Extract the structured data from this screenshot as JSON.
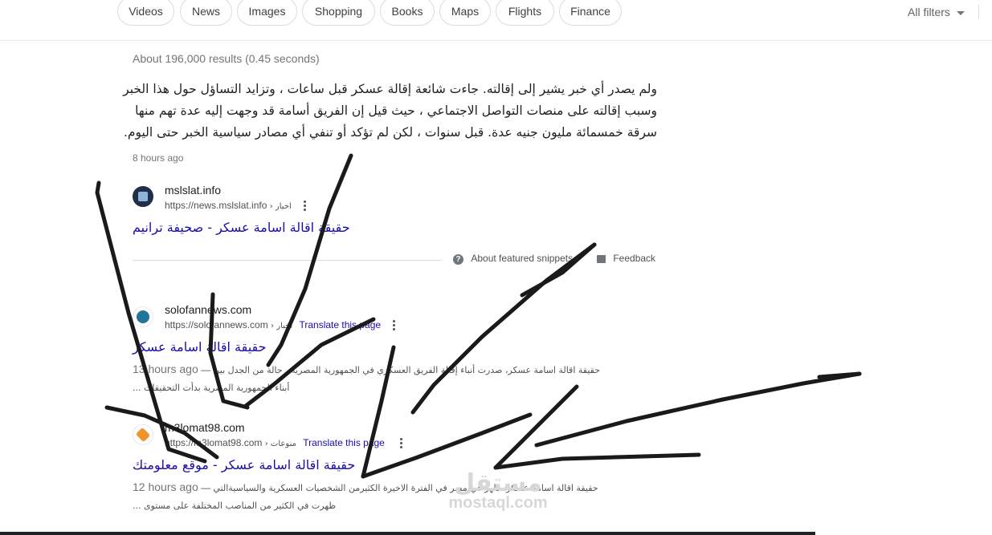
{
  "tabs": [
    {
      "label": "Videos"
    },
    {
      "label": "News"
    },
    {
      "label": "Images"
    },
    {
      "label": "Shopping"
    },
    {
      "label": "Books"
    },
    {
      "label": "Maps"
    },
    {
      "label": "Flights"
    },
    {
      "label": "Finance"
    }
  ],
  "all_filters": "All filters",
  "result_stats": "About 196,000 results (0.45 seconds)",
  "featured_snippet": {
    "lines": [
      "ولم يصدر أي خبر يشير إلى إقالته. جاءت شائعة إقالة عسكر قبل ساعات ، وتزايد التساؤل حول هذا الخبر",
      "وسبب إقالته على منصات التواصل الاجتماعي ، حيث قيل إن الفريق أسامة قد وجهت إليه عدة تهم منها",
      "سرقة خمسمائة مليون جنيه عدة. قبل سنوات ، لكن لم تؤكد أو تنفي أي مصادر سياسية الخبر حتى اليوم."
    ],
    "date": "8 hours ago",
    "source": {
      "site": "mslslat.info",
      "url": "https://news.mslslat.info",
      "crumb": "› اخبار",
      "title": "حقيقة اقالة اسامة عسكر - صحيفة ترانيم"
    },
    "about_label": "About featured snippets",
    "feedback_label": "Feedback"
  },
  "results": [
    {
      "site": "solofannews.com",
      "url": "https://solofannews.com",
      "crumb": "› اخبار",
      "translate": "Translate this page",
      "title": "حقيقة اقالة اسامة عسكر",
      "date": "13 hours ago",
      "snippet_l1": "حقيقة اقالة اسامة عسكر، صدرت أنباء إقالة الفريق العسكري في الجمهورية المصرية ، حالة من الجدل بين",
      "snippet_l2": "أبناء الجمهورية المصرية بدأت التحقيقات ..."
    },
    {
      "site": "m3lomat98.com",
      "url": "https://m3lomat98.com",
      "crumb": "› منوعات",
      "translate": "Translate this page",
      "title": "حقيقة اقالة اسامة عسكر - موقع معلومتك",
      "date": "12 hours ago",
      "snippet_l1": "حقيقة اقالة اسامة عسكر، ظهر في مصر في الفترة الاخيرة الكثيرمن الشخصيات العسكرية والسياسيةالتي",
      "snippet_l2": "ظهرت في الكثير من المناصب المختلفة على مستوى ..."
    }
  ],
  "watermark": {
    "ar": "مستقل",
    "en": "mostaql.com"
  },
  "colors": {
    "link": "#1a0dab",
    "text": "#202124",
    "secondary": "#70757a",
    "ink": "#1a1a1a"
  }
}
